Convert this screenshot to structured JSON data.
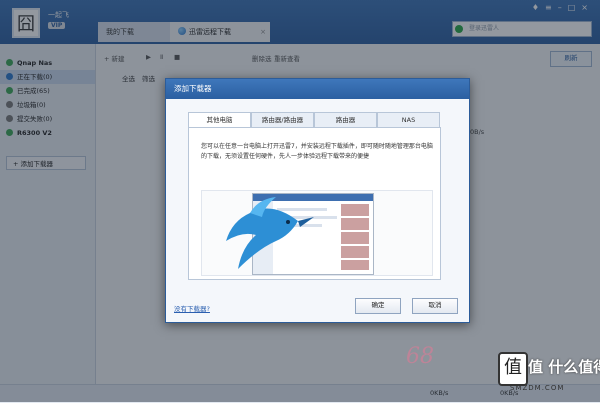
{
  "window": {
    "username": "一起飞",
    "vip_label": "VIP",
    "tabs": [
      "我的下载",
      "迅雷远程下载"
    ],
    "search_placeholder": "登录迅雷人"
  },
  "sidebar": {
    "items": [
      {
        "label": "Qnap Nas",
        "color": "#3aa655"
      },
      {
        "label": "正在下载(0)",
        "color": "#2a75c9"
      },
      {
        "label": "已完成(65)",
        "color": "#3aa655"
      },
      {
        "label": "垃圾箱(0)",
        "color": "#777777"
      },
      {
        "label": "提交失败(0)",
        "color": "#777777"
      },
      {
        "label": "R6300 V2",
        "color": "#3aa655"
      }
    ],
    "add_button": "添加下载器"
  },
  "toolbar": {
    "new_label": "新建",
    "items": [
      "删除选",
      "重新查看"
    ],
    "refresh_label": "刷新",
    "filter_labels": [
      "全选",
      "筛选"
    ]
  },
  "background": {
    "speed_text": "0B/s"
  },
  "dialog": {
    "title": "添加下载器",
    "tabs": [
      "其他电脑",
      "路由器/路由器",
      "路由器",
      "NAS"
    ],
    "description": "您可以在任意一台电脑上打开迅雷7，并安装远程下载插件，即可随时随地管理那台电脑的下载，无须设置任何硬件，先人一步体验远程下载带来的便捷",
    "no_downloader_link": "没有下载器?",
    "ok_button": "确定",
    "cancel_button": "取消"
  },
  "statusbar": {
    "speed_down": "0KB/s",
    "speed_up": "0KB/s"
  },
  "watermark": {
    "text": "值 什么值得买",
    "url": "SMZDM.COM"
  }
}
